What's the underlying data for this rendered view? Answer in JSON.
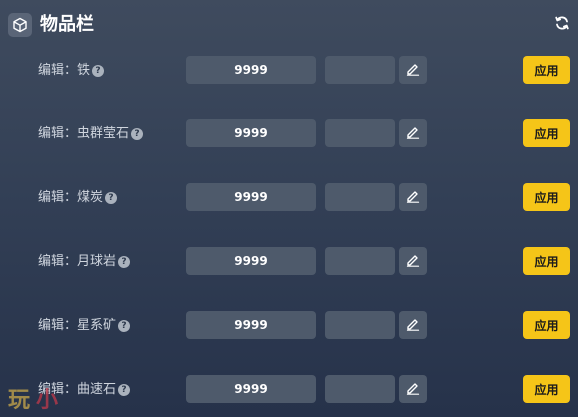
{
  "header": {
    "title": "物品栏",
    "cube_icon": "cube-icon",
    "refresh_icon": "refresh-icon"
  },
  "items": [
    {
      "label": "编辑：铁",
      "value": "9999",
      "apply_label": "应用"
    },
    {
      "label": "编辑：虫群莹石",
      "value": "9999",
      "apply_label": "应用"
    },
    {
      "label": "编辑：煤炭",
      "value": "9999",
      "apply_label": "应用"
    },
    {
      "label": "编辑：月球岩",
      "value": "9999",
      "apply_label": "应用"
    },
    {
      "label": "编辑：星系矿",
      "value": "9999",
      "apply_label": "应用"
    },
    {
      "label": "编辑：曲速石",
      "value": "9999",
      "apply_label": "应用"
    }
  ],
  "watermark": {
    "part1": "玩",
    "part2": "小"
  },
  "colors": {
    "apply": "#f5c518",
    "field": "#4e5a6b"
  }
}
